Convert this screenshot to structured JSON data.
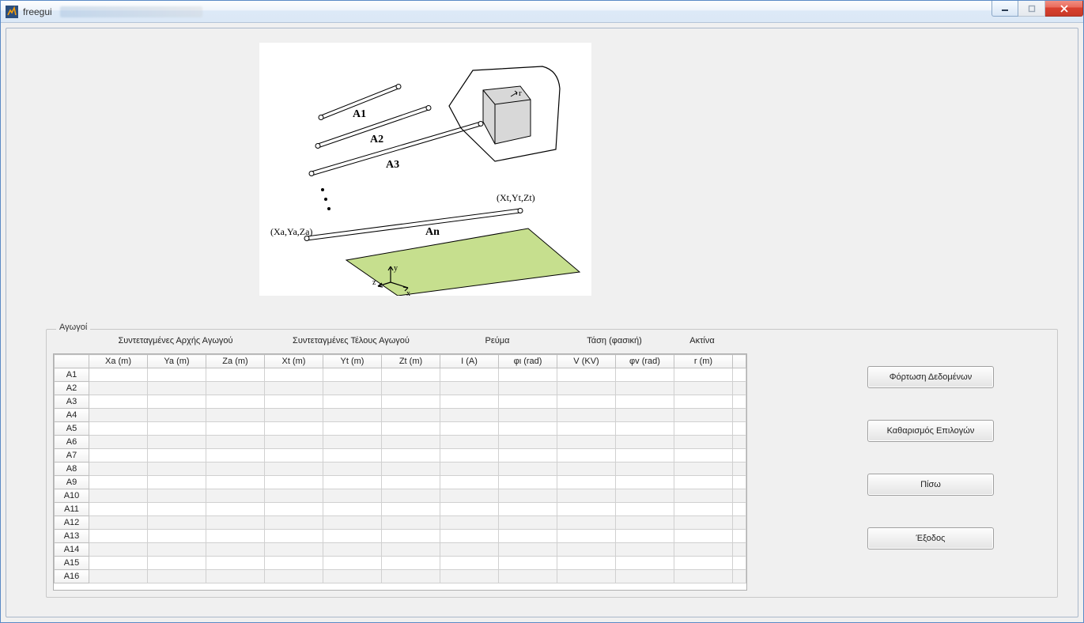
{
  "window": {
    "title": "freegui"
  },
  "diagram": {
    "labels": {
      "a1": "A1",
      "a2": "A2",
      "a3": "A3",
      "an": "An",
      "start_coord": "(Xa,Ya,Za)",
      "end_coord": "(Xt,Yt,Zt)",
      "axis_x": "x",
      "axis_y": "y",
      "axis_z": "z",
      "radius": "r"
    }
  },
  "fieldset": {
    "legend": "Αγωγοί",
    "group_headers": [
      "Συντεταγμένες Αρχής Αγωγού",
      "Συντεταγμένες Τέλους Αγωγού",
      "Ρεύμα",
      "Τάση (φασική)",
      "Ακτίνα"
    ],
    "columns": [
      "Xa (m)",
      "Ya (m)",
      "Za (m)",
      "Xt (m)",
      "Yt (m)",
      "Zt (m)",
      "I (A)",
      "φι (rad)",
      "V (KV)",
      "φv (rad)",
      "r (m)"
    ],
    "rows": [
      "A1",
      "A2",
      "A3",
      "A4",
      "A5",
      "A6",
      "A7",
      "A8",
      "A9",
      "A10",
      "A11",
      "A12",
      "A13",
      "A14",
      "A15",
      "A16"
    ]
  },
  "buttons": {
    "load": "Φόρτωση Δεδομένων",
    "clear": "Καθαρισμός Επιλογών",
    "back": "Πίσω",
    "exit": "Έξοδος"
  }
}
